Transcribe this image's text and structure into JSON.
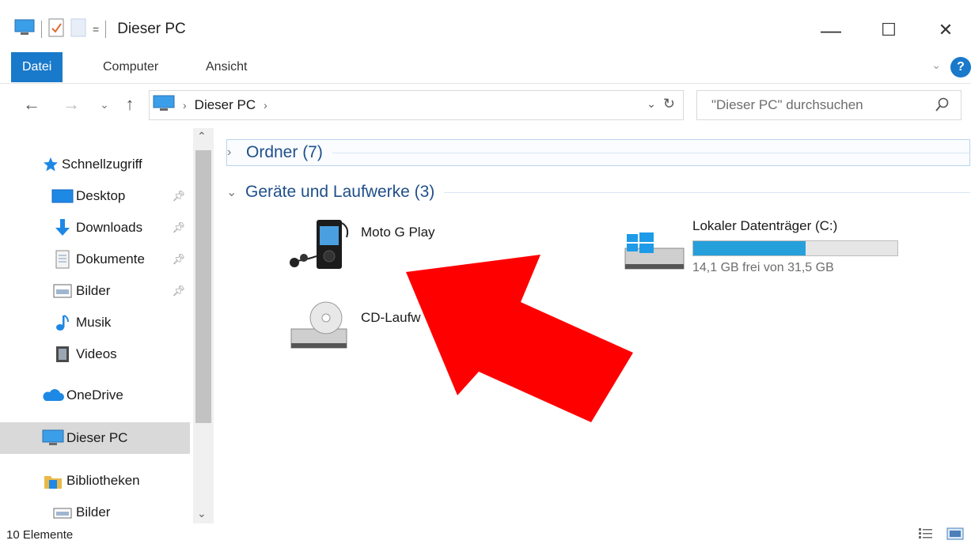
{
  "window": {
    "title": "Dieser PC",
    "minimize_glyph": "—",
    "maximize_glyph": "☐",
    "close_glyph": "✕"
  },
  "ribbon": {
    "tabs": [
      {
        "label": "Datei",
        "active": true
      },
      {
        "label": "Computer",
        "active": false
      },
      {
        "label": "Ansicht",
        "active": false
      }
    ],
    "help_label": "?"
  },
  "nav": {
    "back_glyph": "←",
    "forward_glyph": "→",
    "recent_glyph": "⌄",
    "up_glyph": "↑",
    "address": {
      "crumbs": [
        "Dieser PC"
      ],
      "separator": "›"
    },
    "search": {
      "placeholder": "\"Dieser PC\" durchsuchen"
    }
  },
  "sidebar": {
    "items": [
      {
        "label": "Schnellzugriff",
        "icon": "star-icon",
        "pinned": false
      },
      {
        "label": "Desktop",
        "icon": "desktop-icon",
        "pinned": true
      },
      {
        "label": "Downloads",
        "icon": "download-icon",
        "pinned": true
      },
      {
        "label": "Dokumente",
        "icon": "document-icon",
        "pinned": true
      },
      {
        "label": "Bilder",
        "icon": "pictures-icon",
        "pinned": true
      },
      {
        "label": "Musik",
        "icon": "music-icon",
        "pinned": false
      },
      {
        "label": "Videos",
        "icon": "videos-icon",
        "pinned": false
      },
      {
        "label": "OneDrive",
        "icon": "cloud-icon",
        "pinned": false
      },
      {
        "label": "Dieser PC",
        "icon": "computer-icon",
        "pinned": false,
        "selected": true
      },
      {
        "label": "Bibliotheken",
        "icon": "library-icon",
        "pinned": false
      },
      {
        "label": "Bilder",
        "icon": "pictures-icon",
        "pinned": false
      }
    ]
  },
  "content": {
    "groups": [
      {
        "label": "Ordner (7)",
        "expanded": false
      },
      {
        "label": "Geräte und Laufwerke (3)",
        "expanded": true
      }
    ],
    "devices": [
      {
        "name": "Moto G Play",
        "icon": "media-player-icon"
      },
      {
        "name": "CD-Laufw",
        "icon": "cd-drive-icon"
      },
      {
        "name": "Lokaler Datenträger (C:)",
        "icon": "windows-drive-icon",
        "free_text": "14,1 GB frei von 31,5 GB",
        "used_fraction": 0.552
      }
    ]
  },
  "status": {
    "count_text": "10 Elemente"
  },
  "colors": {
    "accent": "#1979ca",
    "drive_fill": "#26a0da",
    "arrow": "#ff0000",
    "group_text": "#1e4f8a"
  }
}
